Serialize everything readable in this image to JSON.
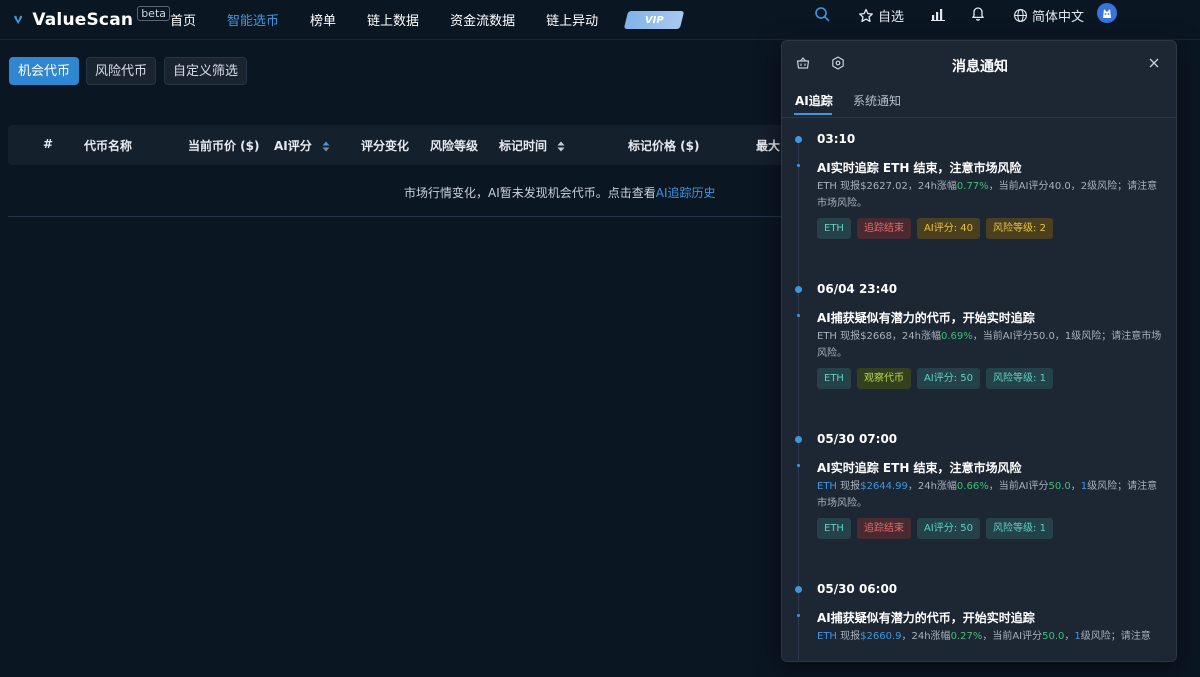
{
  "header": {
    "brand": "ValueScan",
    "beta": "beta",
    "nav": [
      {
        "label": "首页",
        "active": false
      },
      {
        "label": "智能选币",
        "active": true
      },
      {
        "label": "榜单",
        "active": false
      },
      {
        "label": "链上数据",
        "active": false
      },
      {
        "label": "资金流数据",
        "active": false
      },
      {
        "label": "链上异动",
        "active": false
      }
    ],
    "vip": "VIP",
    "favorites": "自选",
    "language": "简体中文"
  },
  "filters": {
    "tabs": [
      {
        "label": "机会代币",
        "active": true
      },
      {
        "label": "风险代币",
        "active": false
      },
      {
        "label": "自定义筛选",
        "active": false
      }
    ]
  },
  "table": {
    "columns": [
      "#",
      "代币名称",
      "当前币价 ($)",
      "AI评分",
      "评分变化",
      "风险等级",
      "标记时间",
      "标记价格 ($)",
      "最大"
    ],
    "empty_message": "市场行情变化，AI暂未发现机会代币。点击查看",
    "empty_link": "AI追踪历史"
  },
  "notifications": {
    "title": "消息通知",
    "tabs": [
      {
        "label": "AI追踪",
        "active": true
      },
      {
        "label": "系统通知",
        "active": false
      }
    ],
    "items": [
      {
        "time": "03:10",
        "title": "AI实时追踪 ETH 结束，注意市场风险",
        "desc_parts": [
          "ETH 现报$2627.02，24h涨幅",
          "0.77%",
          "，当前AI评分40.0，2级风险；请注意市场风险。"
        ],
        "tags": [
          "ETH",
          "追踪结束",
          "AI评分: 40",
          "风险等级: 2"
        ]
      },
      {
        "time": "06/04 23:40",
        "title": "AI捕获疑似有潜力的代币，开始实时追踪",
        "desc_parts": [
          "ETH 现报$2668，24h涨幅",
          "0.69%",
          "，当前AI评分50.0，1级风险；请注意市场风险。"
        ],
        "tags": [
          "ETH",
          "观察代币",
          "AI评分: 50",
          "风险等级: 1"
        ]
      },
      {
        "time": "05/30 07:00",
        "title": "AI实时追踪 ETH 结束，注意市场风险",
        "desc_parts": [
          "ETH",
          " 现报",
          "$2644.99",
          "，24h涨幅",
          "0.66%",
          "，当前AI评分",
          "50.0",
          "，",
          "1",
          "级风险；请注意市场风险。"
        ],
        "tags": [
          "ETH",
          "追踪结束",
          "AI评分: 50",
          "风险等级: 1"
        ]
      },
      {
        "time": "05/30 06:00",
        "title": "AI捕获疑似有潜力的代币，开始实时追踪",
        "desc_parts": [
          "ETH",
          " 现报",
          "$2660.9",
          "，24h涨幅",
          "0.27%",
          "，当前AI评分",
          "50.0",
          "，",
          "1",
          "级风险；请注意"
        ]
      }
    ]
  },
  "colors": {
    "accent": "#3d97df",
    "background": "#0b1623",
    "panel": "#1d2633",
    "up": "#3fbf76"
  }
}
